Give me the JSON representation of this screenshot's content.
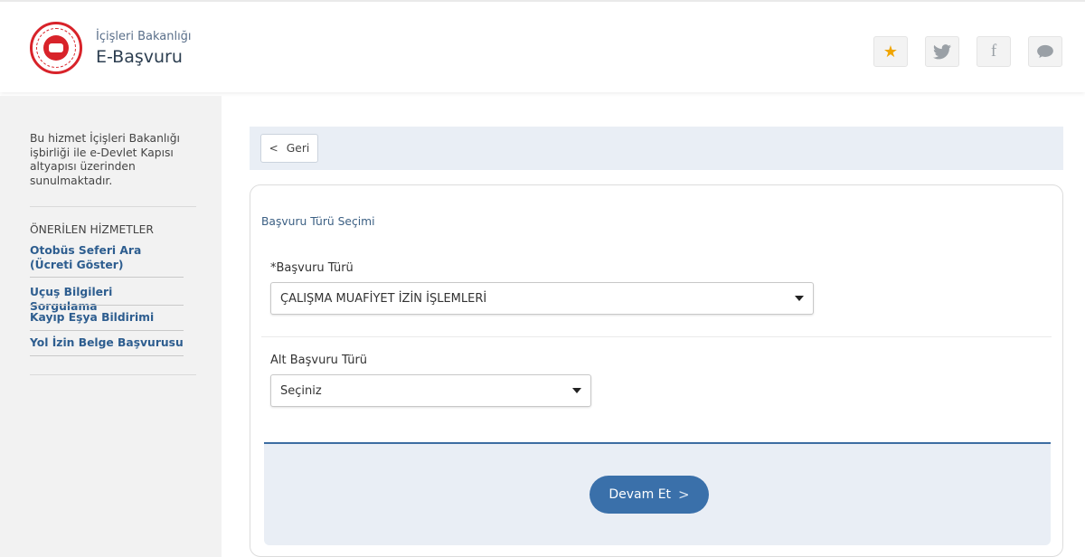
{
  "header": {
    "brand_subtitle": "İçişleri Bakanlığı",
    "brand_title": "E-Başvuru",
    "actions": [
      {
        "icon": "star-icon",
        "glyph": "★"
      },
      {
        "icon": "twitter-icon",
        "glyph": "🐦"
      },
      {
        "icon": "facebook-icon",
        "glyph": "f"
      },
      {
        "icon": "comment-icon",
        "glyph": "💬"
      }
    ]
  },
  "sidebar": {
    "intro": "Bu hizmet İçişleri Bakanlığı işbirliği ile e-Devlet Kapısı altyapısı üzerinden sunulmaktadır.",
    "heading": "ÖNERİLEN HİZMETLER",
    "links": [
      "Otobüs Seferi Ara (Ücreti Göster)",
      "Uçuş Bilgileri Sorgulama",
      "Kayıp Eşya Bildirimi",
      "Yol İzin Belge Başvurusu"
    ]
  },
  "back": {
    "label": "Geri",
    "glyph": "<"
  },
  "form": {
    "section_title": "Başvuru Türü Seçimi",
    "application_type": {
      "label": "*Başvuru Türü",
      "value": "ÇALIŞMA MUAFİYET İZİN İŞLEMLERİ"
    },
    "sub_type": {
      "label": "Alt Başvuru Türü",
      "value": "Seçiniz"
    },
    "continue_label": "Devam Et",
    "continue_glyph": ">"
  },
  "colors": {
    "accent": "#3a70aa",
    "link": "#2d5d8f",
    "panel": "#e9eef5",
    "sidebar": "#f2f2f2"
  }
}
